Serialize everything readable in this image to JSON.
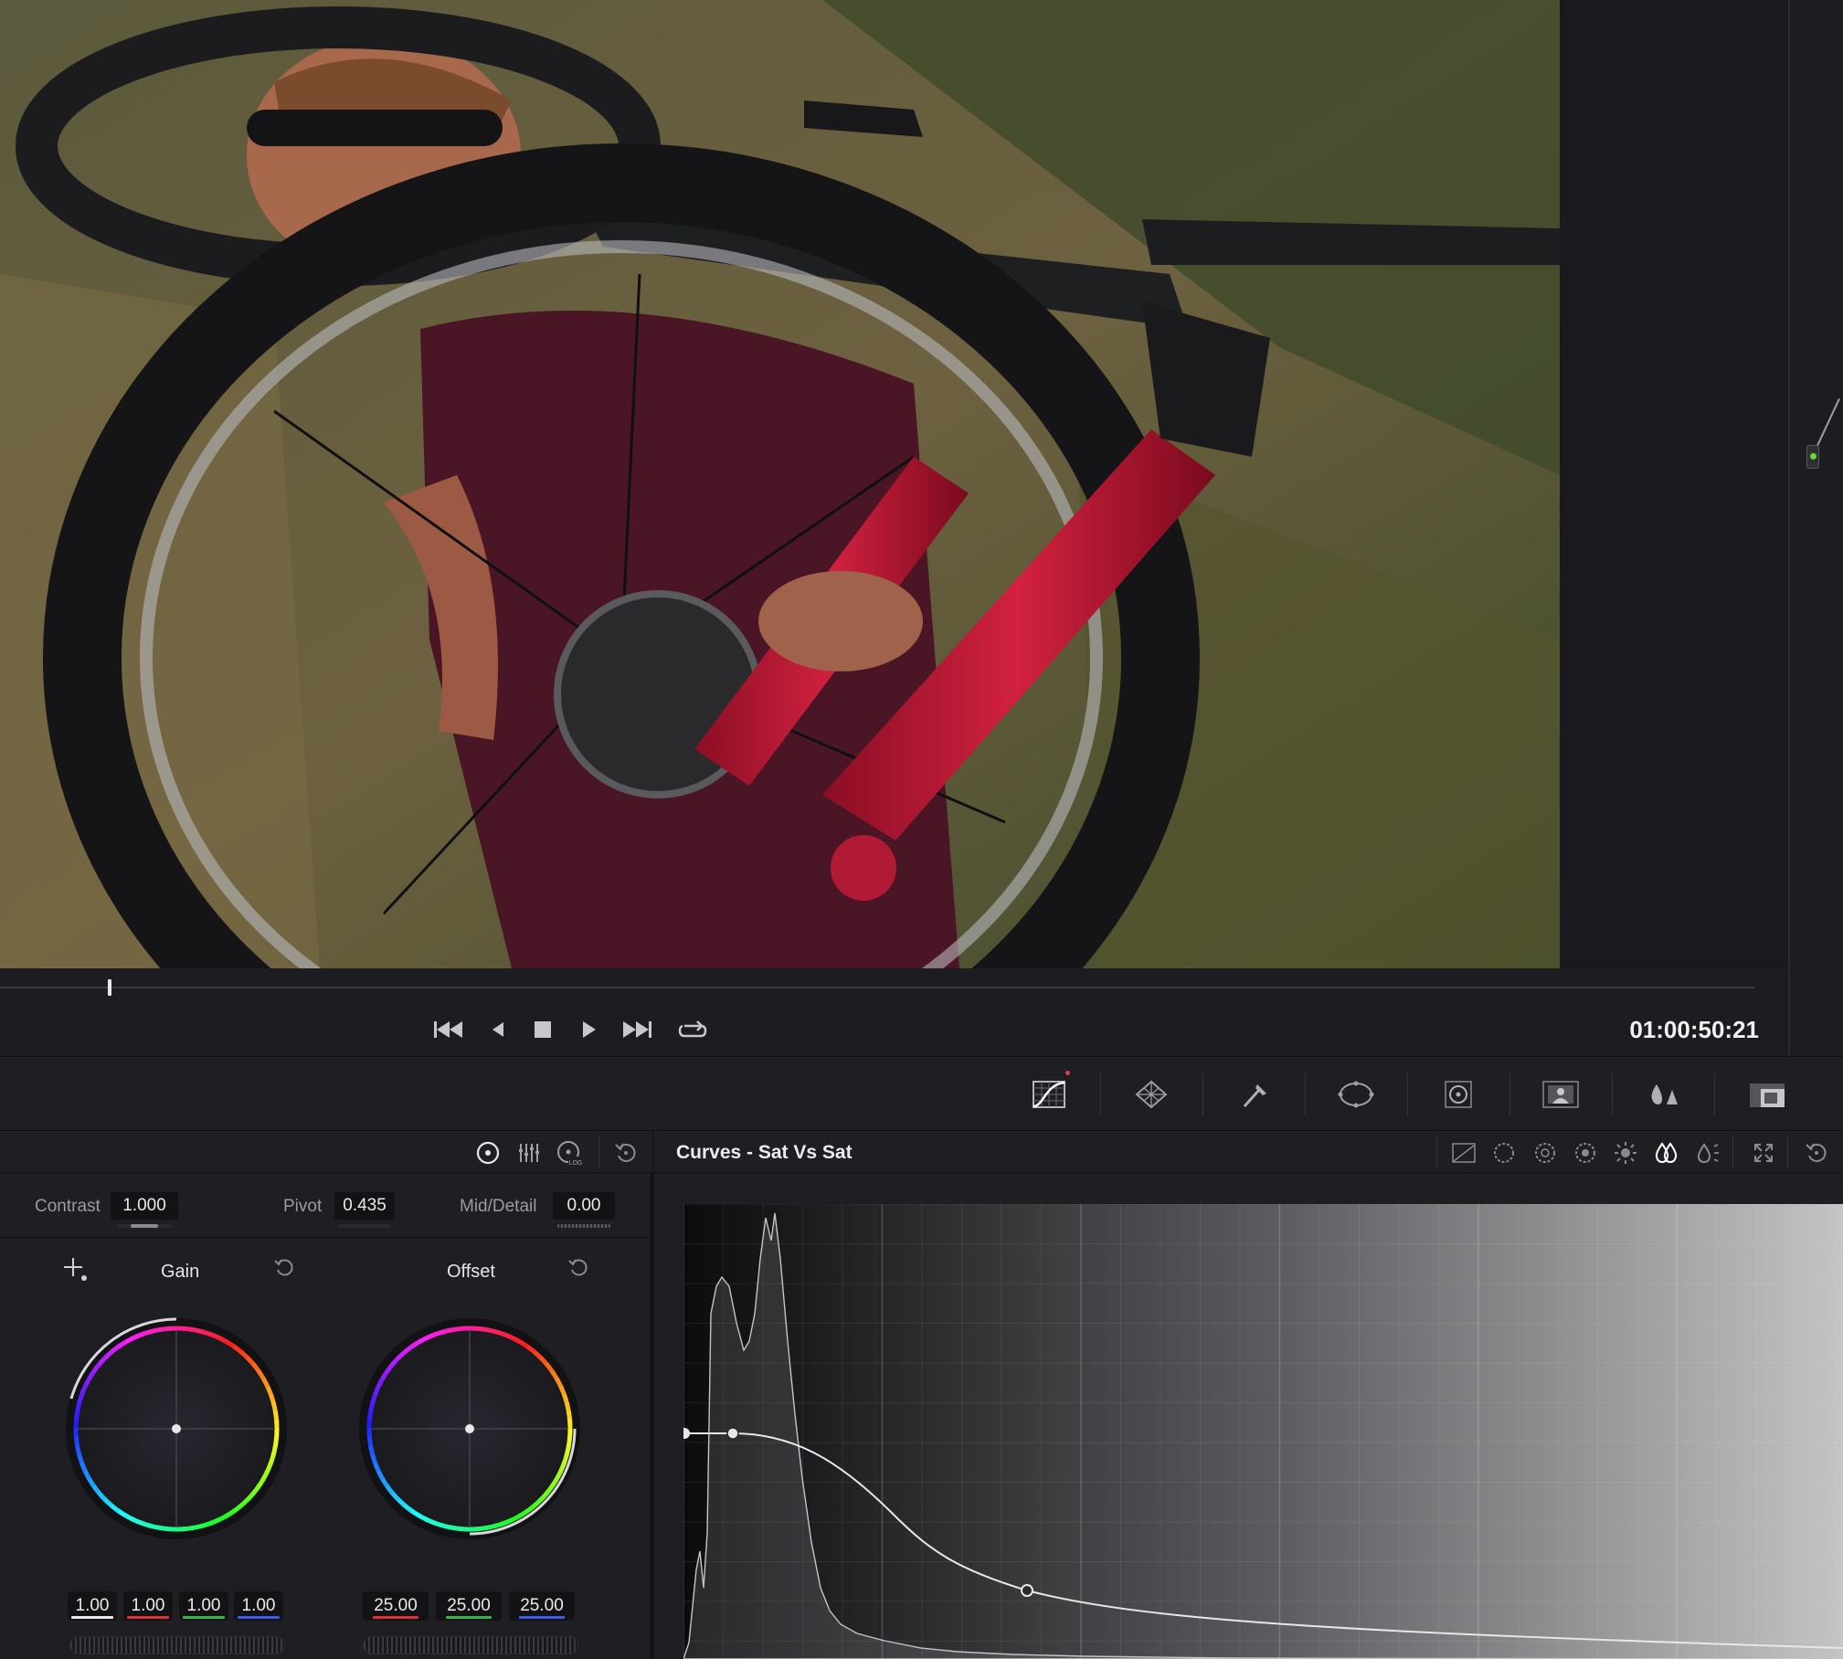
{
  "transport": {
    "timecode": "01:00:50:21",
    "buttons": [
      "skip-to-start",
      "play-reverse",
      "stop",
      "play-forward",
      "skip-to-end",
      "loop"
    ]
  },
  "palette": {
    "tools": [
      "curves-icon",
      "warper-icon",
      "qualifier-icon",
      "window-icon",
      "tracker-icon",
      "magic-mask-icon",
      "blur-icon",
      "key-icon"
    ]
  },
  "primaries": {
    "mode_icons": [
      "color-wheels-icon",
      "primaries-bars-icon",
      "log-wheels-icon",
      "reset-all-icon"
    ],
    "contrast": {
      "label": "Contrast",
      "value": "1.000"
    },
    "pivot": {
      "label": "Pivot",
      "value": "0.435"
    },
    "mid_detail": {
      "label": "Mid/Detail",
      "value": "0.00"
    },
    "gain": {
      "label": "Gain",
      "values": [
        "1.00",
        "1.00",
        "1.00",
        "1.00"
      ]
    },
    "offset": {
      "label": "Offset",
      "values": [
        "25.00",
        "25.00",
        "25.00"
      ]
    }
  },
  "curves": {
    "title": "Curves - Sat Vs Sat",
    "header_icons": [
      "custom-curve-icon",
      "hue-vs-hue-icon",
      "hue-vs-sat-icon",
      "hue-vs-lum-icon",
      "lum-vs-sat-icon",
      "sat-vs-sat-icon",
      "sat-vs-lum-icon",
      "expand-icon",
      "reset-icon"
    ],
    "active_mode": "sat-vs-sat"
  },
  "colors": {
    "panel_bg": "#1e1e23",
    "accent_red": "#e23b3b",
    "accent_green": "#6bd83a",
    "channel_red": "#e0313a",
    "channel_green": "#30b84a",
    "channel_blue": "#3a5cf0"
  }
}
